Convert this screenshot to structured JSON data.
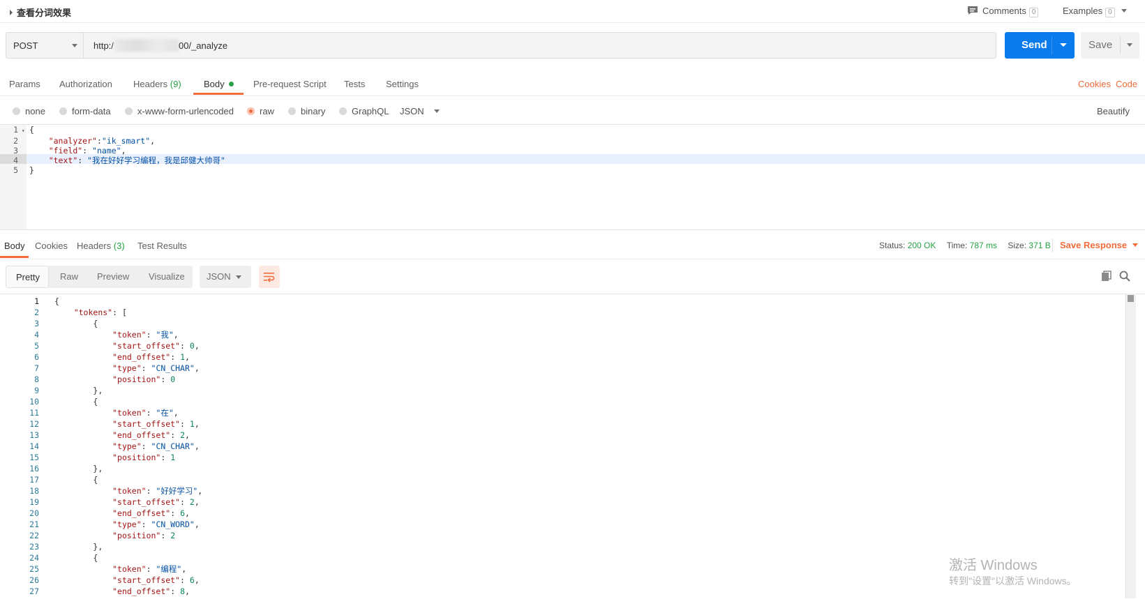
{
  "request": {
    "name": "查看分词效果",
    "comments_label": "Comments",
    "comments_count": "0",
    "examples_label": "Examples",
    "examples_count": "0",
    "method": "POST",
    "url_prefix": "http:/",
    "url_suffix": "00/_analyze",
    "send_label": "Send",
    "save_label": "Save"
  },
  "request_tabs": {
    "params": "Params",
    "authorization": "Authorization",
    "headers": "Headers",
    "headers_count": "(9)",
    "body": "Body",
    "prerequest": "Pre-request Script",
    "tests": "Tests",
    "settings": "Settings",
    "cookies": "Cookies",
    "code": "Code"
  },
  "body_modes": {
    "none": "none",
    "form_data": "form-data",
    "urlencoded": "x-www-form-urlencoded",
    "raw": "raw",
    "binary": "binary",
    "graphql": "GraphQL",
    "format": "JSON",
    "beautify": "Beautify"
  },
  "request_body_lines": [
    "{",
    "    \"analyzer\":\"ik_smart\",",
    "    \"field\": \"name\",",
    "    \"text\": \"我在好好学习编程，我是邱健大帅哥\"",
    "}"
  ],
  "response_tabs": {
    "body": "Body",
    "cookies": "Cookies",
    "headers": "Headers",
    "headers_count": "(3)",
    "test_results": "Test Results"
  },
  "response_status": {
    "status_label": "Status:",
    "status_value": "200 OK",
    "time_label": "Time:",
    "time_value": "787 ms",
    "size_label": "Size:",
    "size_value": "371 B",
    "save_response": "Save Response"
  },
  "response_view": {
    "pretty": "Pretty",
    "raw": "Raw",
    "preview": "Preview",
    "visualize": "Visualize",
    "format": "JSON"
  },
  "response_lines": [
    "{",
    "    \"tokens\": [",
    "        {",
    "            \"token\": \"我\",",
    "            \"start_offset\": 0,",
    "            \"end_offset\": 1,",
    "            \"type\": \"CN_CHAR\",",
    "            \"position\": 0",
    "        },",
    "        {",
    "            \"token\": \"在\",",
    "            \"start_offset\": 1,",
    "            \"end_offset\": 2,",
    "            \"type\": \"CN_CHAR\",",
    "            \"position\": 1",
    "        },",
    "        {",
    "            \"token\": \"好好学习\",",
    "            \"start_offset\": 2,",
    "            \"end_offset\": 6,",
    "            \"type\": \"CN_WORD\",",
    "            \"position\": 2",
    "        },",
    "        {",
    "            \"token\": \"编程\",",
    "            \"start_offset\": 6,",
    "            \"end_offset\": 8,"
  ],
  "watermark": {
    "line1": "激活 Windows",
    "line2": "转到\"设置\"以激活 Windows。"
  },
  "colors": {
    "accent": "#f26b3a",
    "send": "#097bed",
    "success": "#26a145"
  },
  "icons": [
    "comment-icon",
    "copy-icon",
    "search-icon",
    "wrap-icon"
  ]
}
